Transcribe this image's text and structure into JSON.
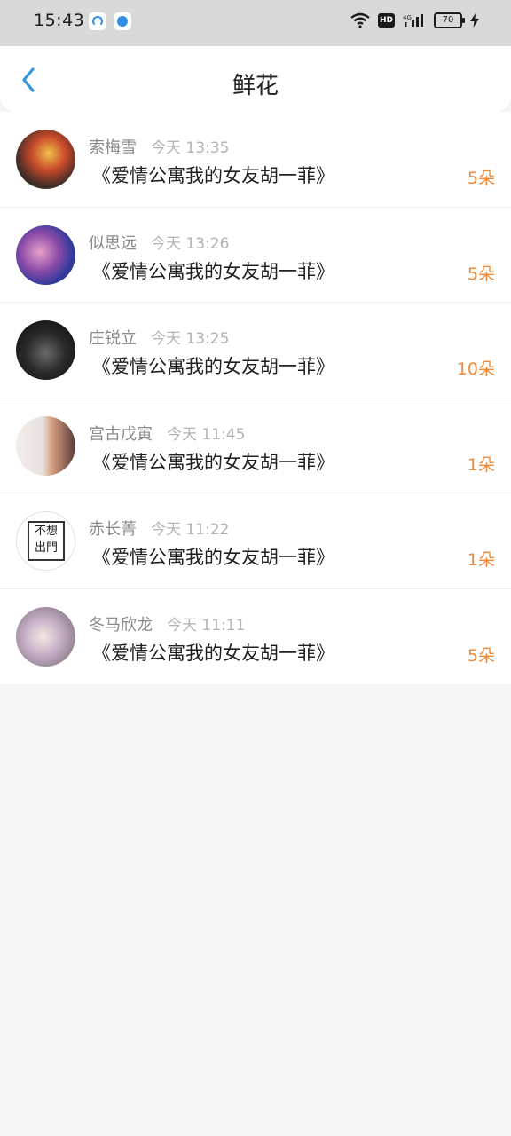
{
  "status_bar": {
    "time": "15:43",
    "network": "4G",
    "battery": "70"
  },
  "header": {
    "title": "鲜花"
  },
  "gifts": [
    {
      "name": "索梅雪",
      "time": "今天 13:35",
      "book": "《爱情公寓我的女友胡一菲》",
      "count": "5朵"
    },
    {
      "name": "似思远",
      "time": "今天 13:26",
      "book": "《爱情公寓我的女友胡一菲》",
      "count": "5朵"
    },
    {
      "name": "庄锐立",
      "time": "今天 13:25",
      "book": "《爱情公寓我的女友胡一菲》",
      "count": "10朵"
    },
    {
      "name": "宫古戊寅",
      "time": "今天 11:45",
      "book": "《爱情公寓我的女友胡一菲》",
      "count": "1朵"
    },
    {
      "name": "赤长菁",
      "time": "今天 11:22",
      "book": "《爱情公寓我的女友胡一菲》",
      "count": "1朵"
    },
    {
      "name": "冬马欣龙",
      "time": "今天 11:11",
      "book": "《爱情公寓我的女友胡一菲》",
      "count": "5朵"
    }
  ],
  "avatar5_text": "不想出門",
  "colors": {
    "accent_back": "#2f9ae0",
    "count_orange": "#f08a3a",
    "background": "#f7f6f7"
  }
}
